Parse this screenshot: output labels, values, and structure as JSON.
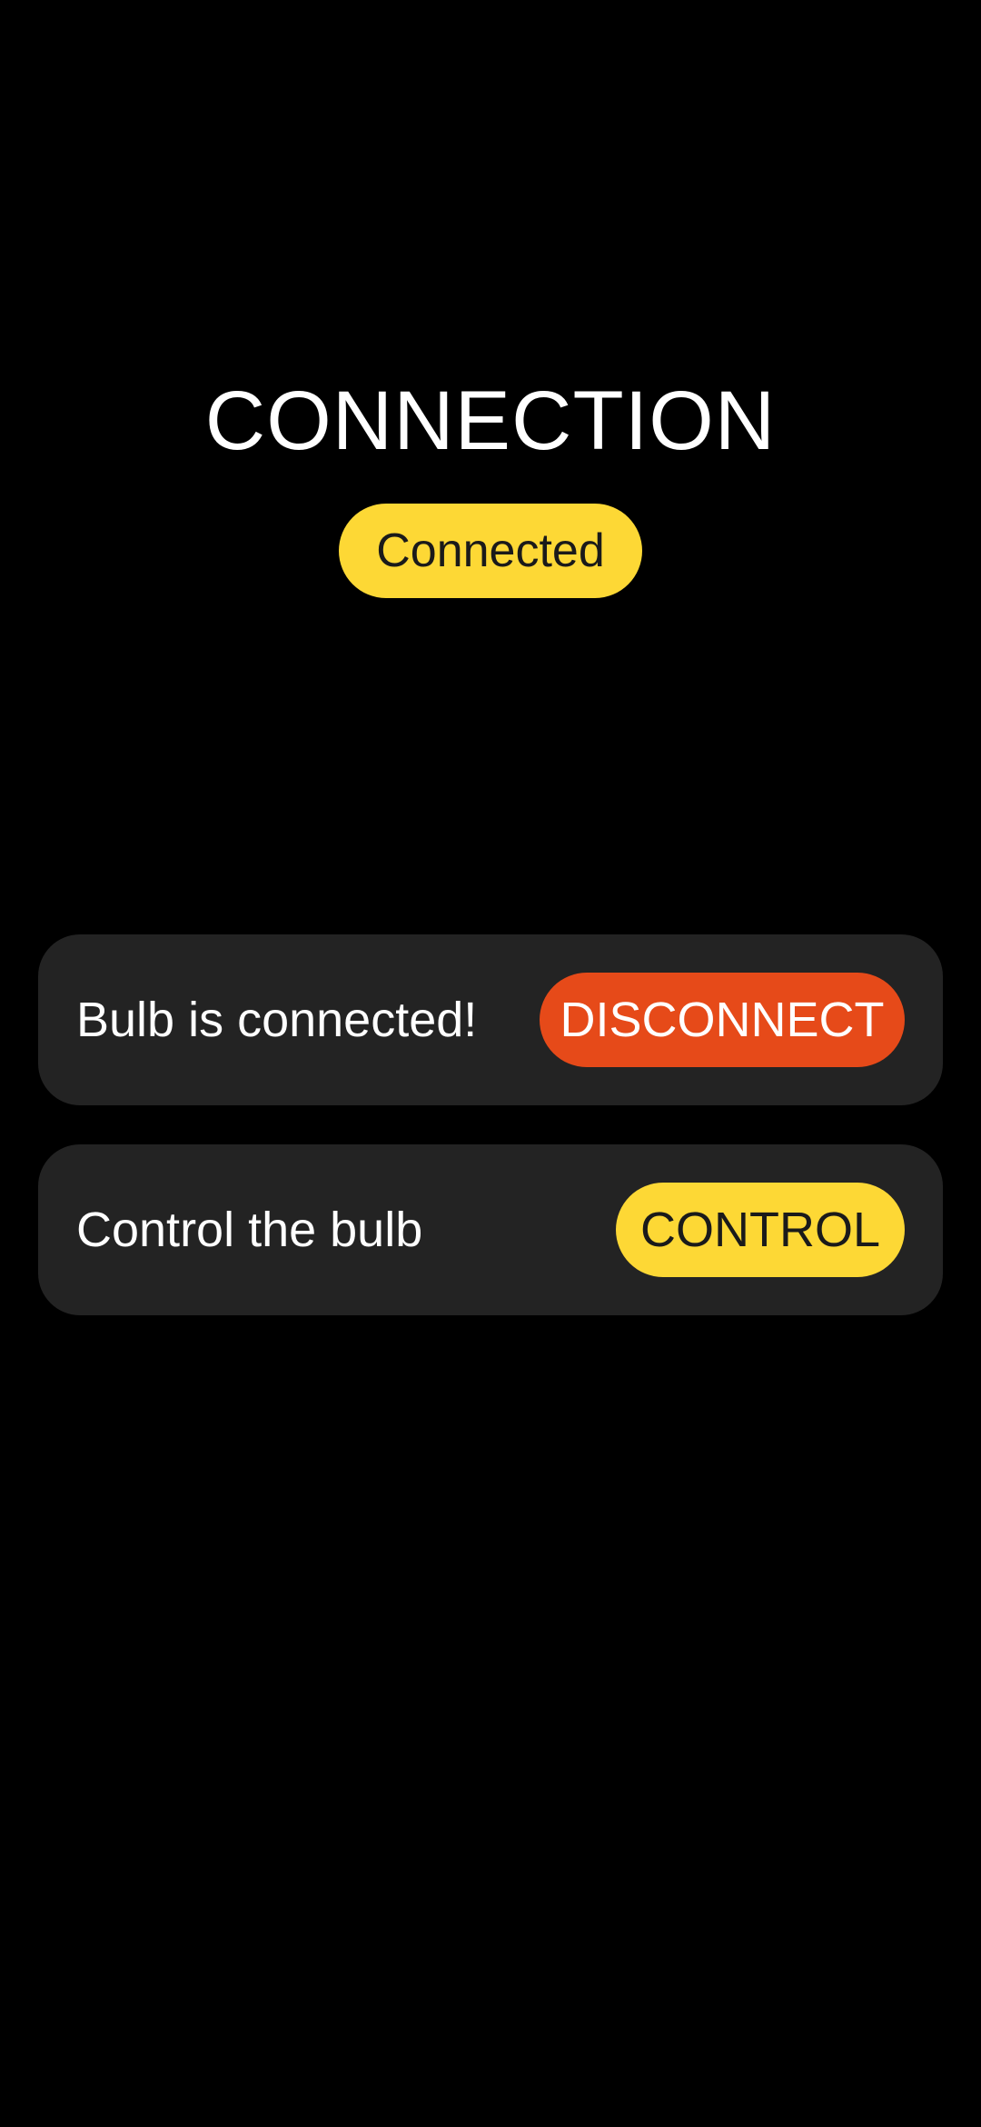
{
  "header": {
    "title": "CONNECTION",
    "status": "Connected"
  },
  "cards": {
    "connection": {
      "label": "Bulb is connected!",
      "button_label": "DISCONNECT"
    },
    "control": {
      "label": "Control the bulb",
      "button_label": "CONTROL"
    }
  },
  "colors": {
    "background": "#000000",
    "card": "#232323",
    "accent_yellow": "#fdd835",
    "accent_red": "#e64a19",
    "text_light": "#ffffff",
    "text_dark": "#1a1a1a"
  }
}
